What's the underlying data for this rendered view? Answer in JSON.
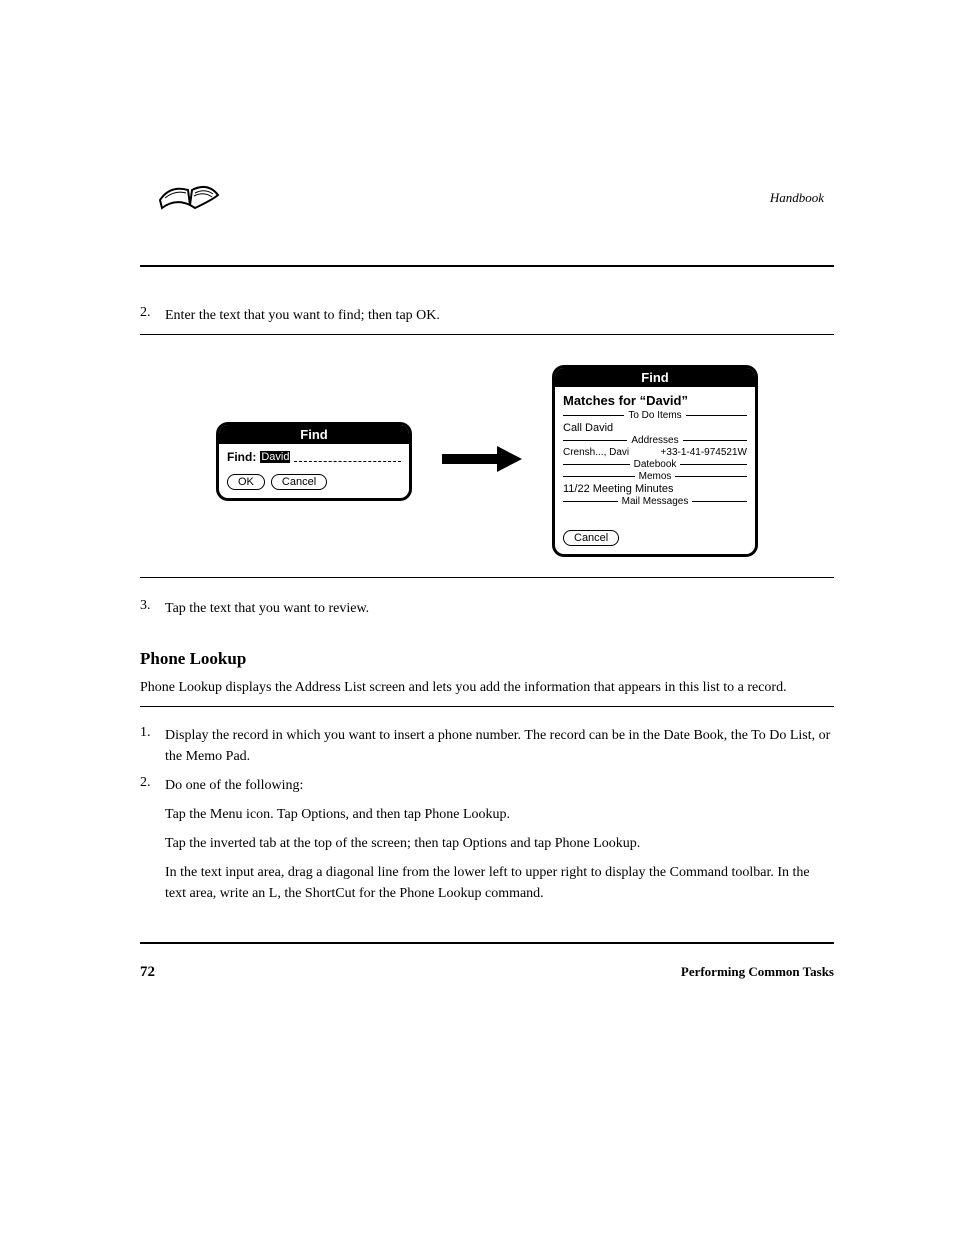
{
  "handbook_ref": "Handbook",
  "step2": {
    "num": "2.",
    "text": "Enter the text that you want to find; then tap OK."
  },
  "find_dialog": {
    "title": "Find",
    "label": "Find:",
    "value": "David",
    "ok": "OK",
    "cancel": "Cancel"
  },
  "results_dialog": {
    "title": "Find",
    "matches": "Matches for “David”",
    "sections": {
      "todo": "To Do Items",
      "todo_item": "Call David",
      "addresses": "Addresses",
      "addr_name": "Crensh..., Davi",
      "addr_phone": "+33-1-41-974521W",
      "datebook": "Datebook",
      "memos": "Memos",
      "memo_item": "11/22 Meeting Minutes",
      "mail": "Mail Messages"
    },
    "cancel": "Cancel"
  },
  "step3": {
    "num": "3.",
    "text": "Tap the text that you want to review."
  },
  "phone_lookup": {
    "heading": "Phone Lookup",
    "intro": "Phone Lookup displays the Address List screen and lets you add the information that appears in this list to a record.",
    "step1_num": "1.",
    "step1_text": "Display the record in which you want to insert a phone number. The record can be in the Date Book, the To Do List, or the Memo Pad.",
    "step2_num": "2.",
    "step2_text": "Do one of the following:",
    "opt_a": "Tap the Menu icon. Tap Options, and then tap Phone Lookup.",
    "opt_b": "Tap the inverted tab at the top of the screen; then tap Options and tap Phone Lookup.",
    "opt_c": "In the text input area, drag a diagonal line from the lower left to upper right to display the Command toolbar. In the text area, write an L, the ShortCut for the Phone Lookup command."
  },
  "footer": {
    "page": "72",
    "text": "Performing Common Tasks"
  }
}
